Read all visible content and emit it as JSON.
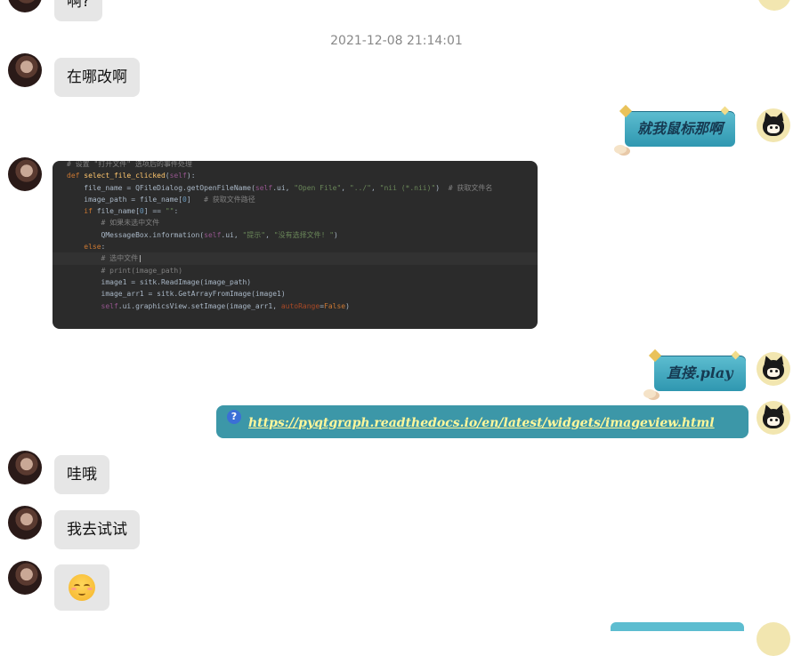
{
  "messages": {
    "m1": "啊?",
    "timestamp": "2021-12-08 21:14:01",
    "m2": "在哪改啊",
    "s1": "就我鼠标那啊",
    "s2": "直接.play",
    "link": "https://pyqtgraph.readthedocs.io/en/latest/widgets/imageview.html",
    "m3": "哇哦",
    "m4": "我去试试"
  },
  "code": {
    "lines": [
      "# 设置 \"打开文件\" 选项后的事件处理",
      "def select_file_clicked(self):",
      "    file_name = QFileDialog.getOpenFileName(self.ui, \"Open File\", \"../\", \"nii (*.nii)\")  # 获取文件名",
      "    image_path = file_name[0]   # 获取文件路径",
      "    if file_name[0] == \"\":",
      "        # 如果未选中文件",
      "        QMessageBox.information(self.ui, \"提示\", \"没有选择文件! \")",
      "    else:",
      "        # 选中文件",
      "        # print(image_path)",
      "        image1 = sitk.ReadImage(image_path)",
      "        image_arr1 = sitk.GetArrayFromImage(image1)",
      "        self.ui.graphicsView.setImage(image_arr1, autoRange=False)"
    ]
  },
  "icons": {
    "link_badge": "question-mark-icon",
    "emoji": "relieved-face-emoji"
  },
  "colors": {
    "bubble_left": "#e6e6e6",
    "sticker": "#3c97a8",
    "link_text": "#fff79a",
    "code_bg": "#2b2b2b",
    "timestamp": "#888888"
  }
}
